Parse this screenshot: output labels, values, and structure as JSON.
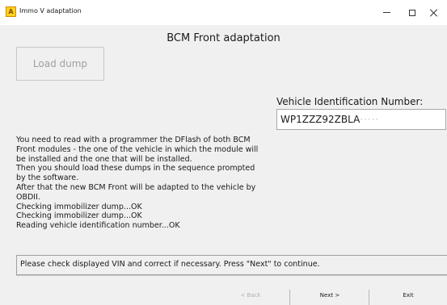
{
  "window": {
    "app_icon_letter": "A",
    "title": "Immo V adaptation"
  },
  "main": {
    "heading": "BCM Front adaptation",
    "load_dump_label": "Load dump",
    "vin_label": "Vehicle Identification Number:",
    "vin_value": "WP1ZZZ92ZBLA",
    "vin_obscured": "·····",
    "info_lines": [
      "You need to read with a programmer the DFlash of both BCM",
      "Front modules - the one of the vehicle in which the module will",
      "be installed and the one that will be installed.",
      "Then you should load these dumps in the sequence prompted",
      "by the software.",
      "After that the new BCM Front will be adapted to the vehicle by",
      "OBDII.",
      "Checking immobilizer dump...OK",
      "Checking immobilizer dump...OK",
      "Reading vehicle identification number...OK"
    ],
    "status_message": "Please check displayed VIN and correct if necessary. Press \"Next\" to continue."
  },
  "footer": {
    "back_label": "< Back",
    "next_label": "Next >",
    "exit_label": "Exit"
  }
}
